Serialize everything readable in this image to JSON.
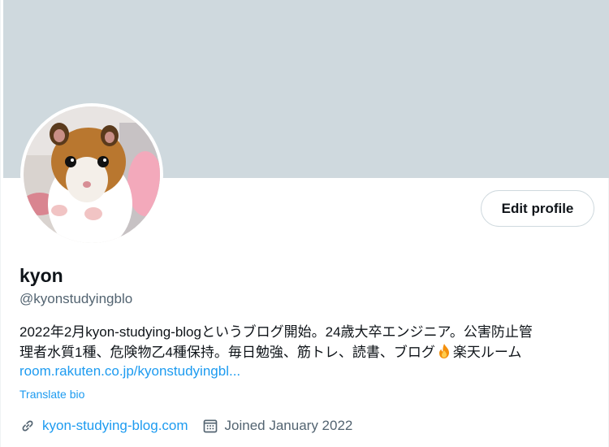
{
  "profile": {
    "name": "kyon",
    "handle": "@kyonstudyingblo",
    "edit_button": "Edit profile",
    "bio_line1": "2022年2月kyon-studying-blogというブログ開始。24歳大卒エンジニア。公害防止管",
    "bio_line2_before": "理者水質1種、危険物乙4種保持。毎日勉強、筋トレ、読書、ブログ",
    "bio_line2_after": "楽天ルーム",
    "bio_emoji": "fire-icon",
    "bio_link": "room.rakuten.co.jp/kyonstudyingbl...",
    "translate": "Translate bio",
    "website": "kyon-studying-blog.com",
    "joined": "Joined January 2022"
  },
  "colors": {
    "banner": "#cfd9de",
    "link": "#1d9bf0",
    "secondary_text": "#536471",
    "primary_text": "#0f1419"
  },
  "icons": {
    "website": "link-icon",
    "joined": "calendar-icon"
  }
}
